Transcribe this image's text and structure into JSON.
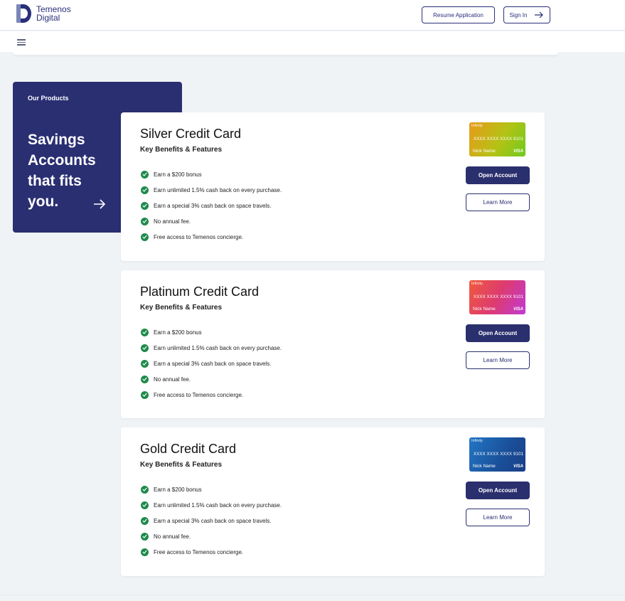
{
  "brand": {
    "line1": "Temenos",
    "line2": "Digital",
    "accent": "#2a2f7a"
  },
  "header": {
    "resume_label": "Resume Application",
    "signin_label": "Sign In"
  },
  "menu": {
    "icon": "hamburger-icon"
  },
  "promo": {
    "label": "Our Products",
    "headline": "Savings Accounts that fits you.",
    "background": "#2a2f72",
    "icon": "arrow-right-icon"
  },
  "products": [
    {
      "title": "Silver Credit Card",
      "subtitle": "Key Benefits & Features",
      "features": [
        "Earn a $200 bonus",
        "Earn unlimited 1.5% cash back on every purchase.",
        "Earn a special 3% cash back on space travels.",
        "No annual fee.",
        "Free access to Temenos concierge."
      ],
      "card_brand": "Infinity",
      "card_number": "XXXX XXXX XXXX 9101",
      "card_holder": "Nick Name",
      "card_network": "VISA",
      "open_label": "Open Account",
      "learn_label": "Learn More"
    },
    {
      "title": "Platinum Credit Card",
      "subtitle": "Key Benefits & Features",
      "features": [
        "Earn a $200 bonus",
        "Earn unlimited 1.5% cash back on every purchase.",
        "Earn a special 3% cash back on space travels.",
        "No annual fee.",
        "Free access to Temenos concierge."
      ],
      "card_brand": "Infinity",
      "card_number": "XXXX XXXX XXXX 9101",
      "card_holder": "Nick Name",
      "card_network": "VISA",
      "open_label": "Open Account",
      "learn_label": "Learn More"
    },
    {
      "title": "Gold Credit Card",
      "subtitle": "Key Benefits & Features",
      "features": [
        "Earn a $200 bonus",
        "Earn unlimited 1.5% cash back on every purchase.",
        "Earn a special 3% cash back on space travels.",
        "No annual fee.",
        "Free access to Temenos concierge."
      ],
      "card_brand": "Infinity",
      "card_number": "XXXX XXXX XXXX 9101",
      "card_holder": "Nick Name",
      "card_network": "VISA",
      "open_label": "Open Account",
      "learn_label": "Learn More"
    }
  ],
  "colors": {
    "primary": "#2a2f6e",
    "check": "#1e8a4c",
    "page_bg": "#f0f3f6"
  }
}
